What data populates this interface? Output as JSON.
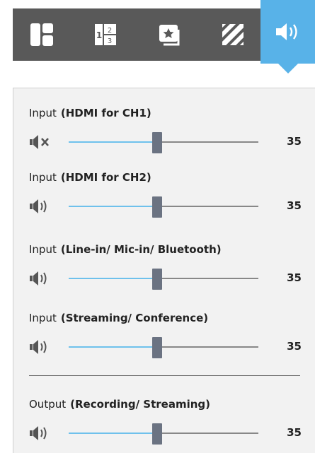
{
  "toolbar": {
    "items": [
      {
        "icon": "layout-icon"
      },
      {
        "icon": "numbered-split-icon"
      },
      {
        "icon": "favorite-frame-icon"
      },
      {
        "icon": "stripes-icon"
      },
      {
        "icon": "speaker-icon",
        "active": true
      }
    ],
    "accent": "#58b2e8"
  },
  "panel": {
    "rows": [
      {
        "prefix": "Input",
        "qualifier": "(HDMI for CH1)",
        "muted": true,
        "value": "35",
        "level": 35
      },
      {
        "prefix": "Input",
        "qualifier": "(HDMI for CH2)",
        "muted": false,
        "value": "35",
        "level": 35
      },
      {
        "prefix": "Input",
        "qualifier": "(Line-in/ Mic-in/ Bluetooth)",
        "muted": false,
        "value": "35",
        "level": 35
      },
      {
        "prefix": "Input",
        "qualifier": "(Streaming/ Conference)",
        "muted": false,
        "value": "35",
        "level": 35
      },
      {
        "prefix": "Output",
        "qualifier": "(Recording/ Streaming)",
        "muted": false,
        "value": "35",
        "level": 35
      }
    ]
  }
}
